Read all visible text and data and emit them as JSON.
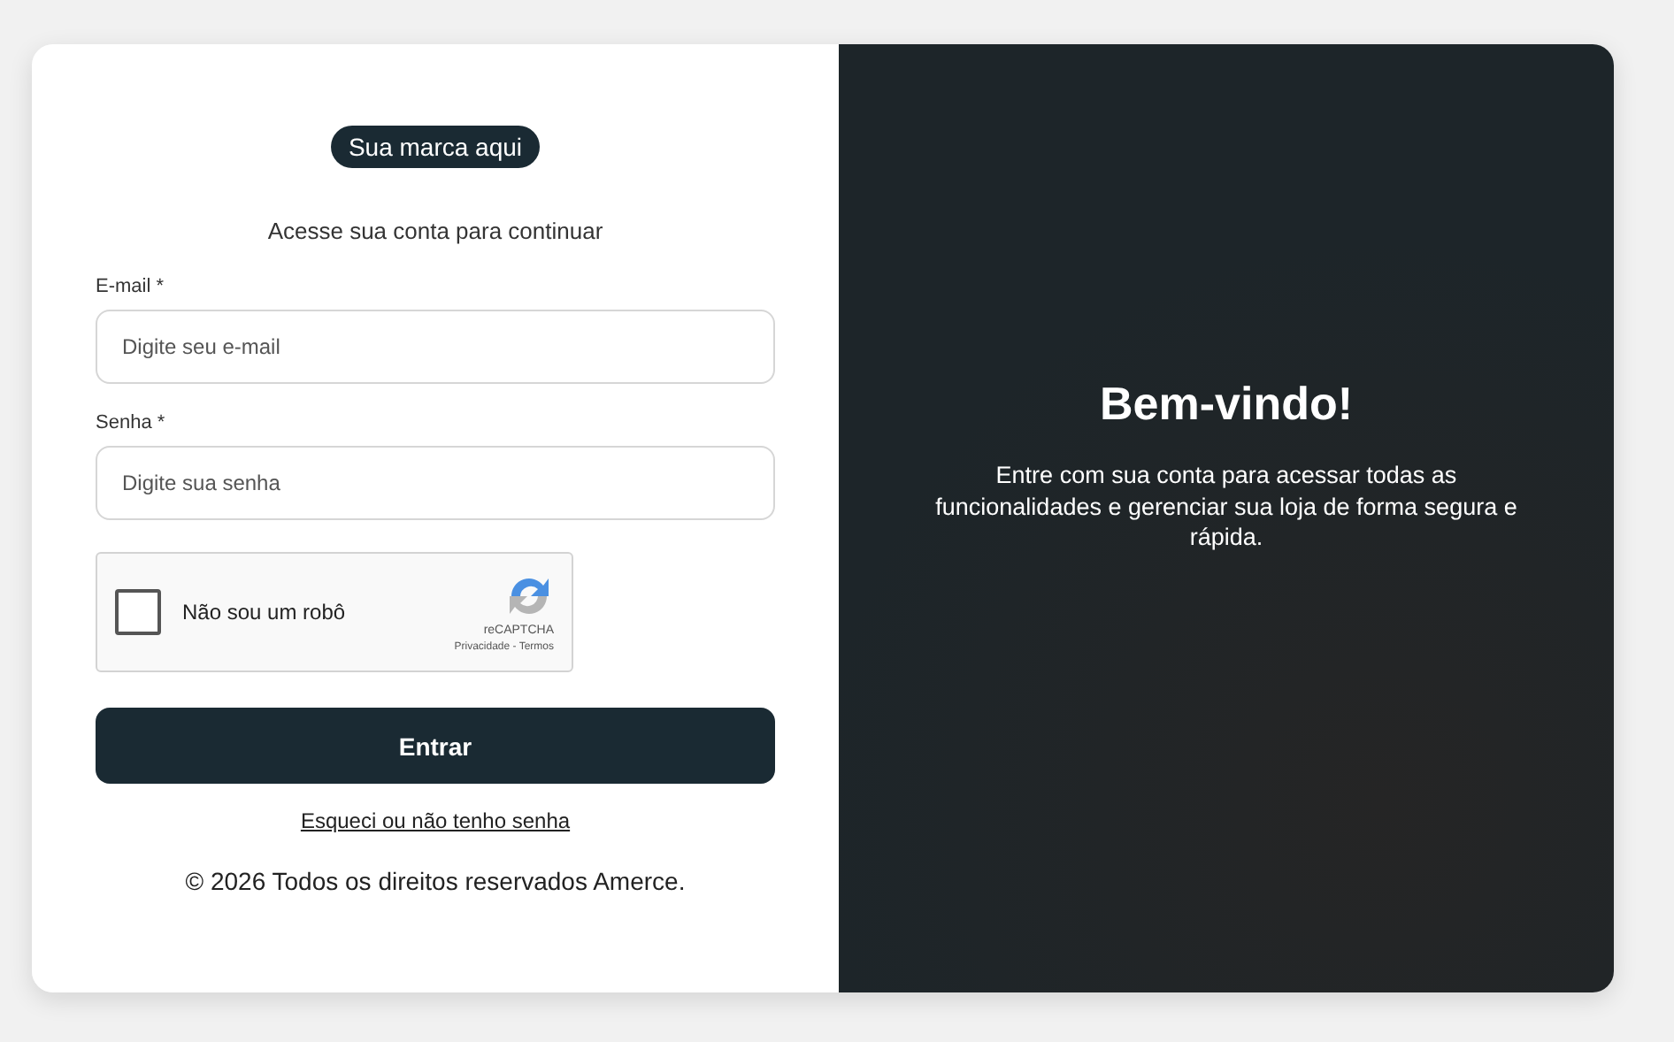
{
  "brand": "Sua marca aqui",
  "subtitle": "Acesse sua conta para continuar",
  "fields": [
    {
      "label": "E-mail *",
      "placeholder": "Digite seu e-mail"
    },
    {
      "label": "Senha *",
      "placeholder": "Digite sua senha"
    }
  ],
  "captcha": {
    "label": "Não sou um robô",
    "checked": false,
    "brand": "reCAPTCHA",
    "links": "Privacidade - Termos"
  },
  "submit": "Entrar",
  "forgot_link": "Esqueci ou não tenho senha",
  "footer": "© 2026 Todos os direitos reservados Amerce.",
  "welcome": {
    "title": "Bem-vindo!",
    "text": "Entre com sua conta para acessar todas as funcionalidades e gerenciar sua loja de forma segura e rápida."
  }
}
